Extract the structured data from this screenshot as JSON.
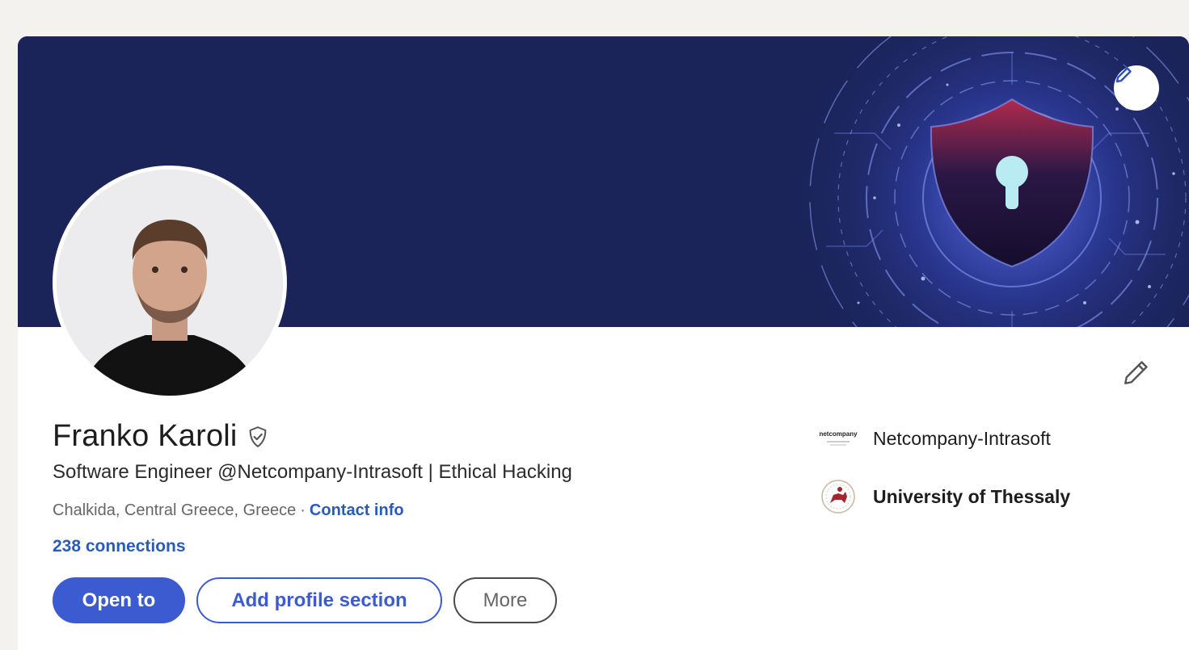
{
  "profile": {
    "name": "Franko Karoli",
    "headline": "Software Engineer @Netcompany-Intrasoft | Ethical Hacking",
    "location": "Chalkida, Central Greece, Greece",
    "separator": "·",
    "contact_label": "Contact info",
    "connections": "238 connections"
  },
  "actions": {
    "open_to": "Open to",
    "add_section": "Add profile section",
    "more": "More"
  },
  "organizations": [
    {
      "name": "Netcompany-Intrasoft",
      "logo_text": "netcompany"
    },
    {
      "name": "University of Thessaly"
    }
  ],
  "icons": {
    "banner_edit": "pencil-icon",
    "intro_edit": "pencil-icon",
    "verified": "shield-check-icon"
  },
  "colors": {
    "banner": "#1b2459",
    "accent": "#3d5bd1",
    "link": "#2a5bb8",
    "page_bg": "#f3f2ef"
  }
}
